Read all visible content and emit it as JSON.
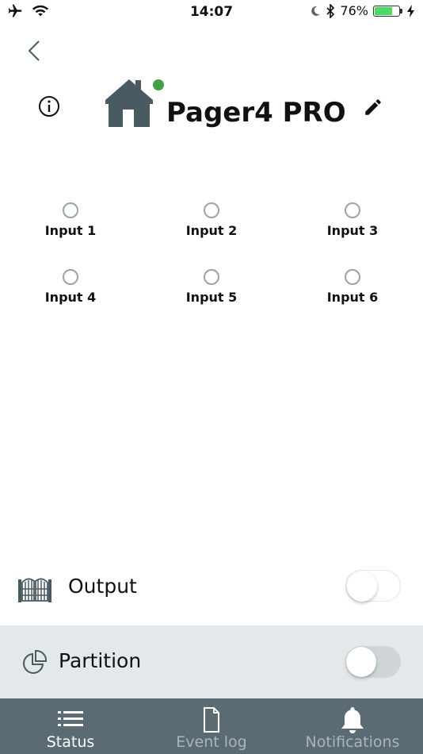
{
  "status_bar": {
    "time": "14:07",
    "battery_text": "76%",
    "battery_level": 0.76
  },
  "header": {
    "device_name": "Pager4 PRO",
    "online_color": "#43a047"
  },
  "inputs": [
    {
      "label": "Input 1"
    },
    {
      "label": "Input 2"
    },
    {
      "label": "Input 3"
    },
    {
      "label": "Input 4"
    },
    {
      "label": "Input 5"
    },
    {
      "label": "Input 6"
    }
  ],
  "controls": {
    "output": {
      "label": "Output",
      "on": false,
      "icon": "gate-icon"
    },
    "partition": {
      "label": "Partition",
      "on": false,
      "icon": "pie-chart-icon"
    }
  },
  "tabs": [
    {
      "label": "Status",
      "icon": "list-icon",
      "active": true
    },
    {
      "label": "Event log",
      "icon": "document-icon",
      "active": false
    },
    {
      "label": "Notifications",
      "icon": "bell-icon",
      "active": false
    }
  ],
  "colors": {
    "icon_dark": "#4a5a63",
    "tabbar_bg": "#5a6b73",
    "partition_row_bg": "#e3e8eb"
  }
}
